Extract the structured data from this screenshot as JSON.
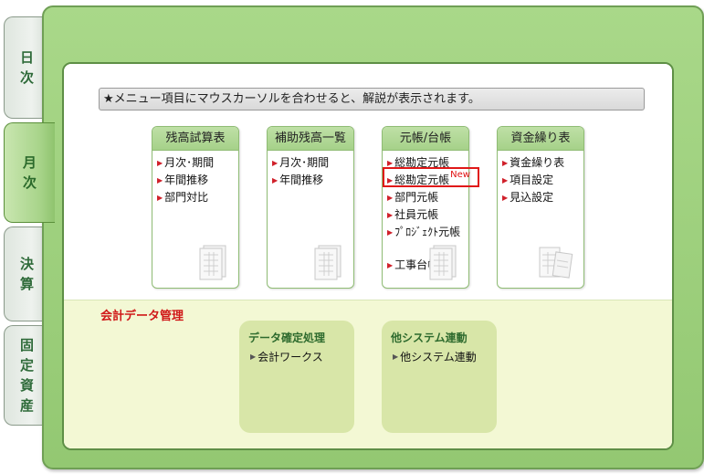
{
  "tabs": [
    {
      "id": "daily",
      "chars": [
        "日",
        "次"
      ],
      "active": false
    },
    {
      "id": "monthly",
      "chars": [
        "月",
        "次"
      ],
      "active": true
    },
    {
      "id": "settlement",
      "chars": [
        "決",
        "算"
      ],
      "active": false
    },
    {
      "id": "fixed_assets",
      "chars": [
        "固",
        "定",
        "資",
        "産"
      ],
      "active": false
    }
  ],
  "hint": "★メニュー項目にマウスカーソルを合わせると、解説が表示されます。",
  "cards": [
    {
      "title": "残高試算表",
      "items": [
        "月次･期間",
        "年間推移",
        "部門対比"
      ]
    },
    {
      "title": "補助残高一覧",
      "items": [
        "月次･期間",
        "年間推移"
      ]
    },
    {
      "title": "元帳/台帳",
      "items": [
        "総勘定元帳",
        "総勘定元帳",
        "部門元帳",
        "社員元帳",
        "ﾌﾟﾛｼﾞｪｸﾄ元帳",
        "工事台帳"
      ],
      "new_badge": "New"
    },
    {
      "title": "資金繰り表",
      "items": [
        "資金繰り表",
        "項目設定",
        "見込設定"
      ]
    }
  ],
  "data_section": {
    "title": "会計データ管理",
    "boxes": [
      {
        "title": "データ確定処理",
        "item": "会計ワークス"
      },
      {
        "title": "他システム連動",
        "item": "他システム連動"
      }
    ]
  },
  "colors": {
    "frame_green": "#93c872",
    "lower_bg": "#f3f8d4",
    "accent_red": "#e01818"
  }
}
